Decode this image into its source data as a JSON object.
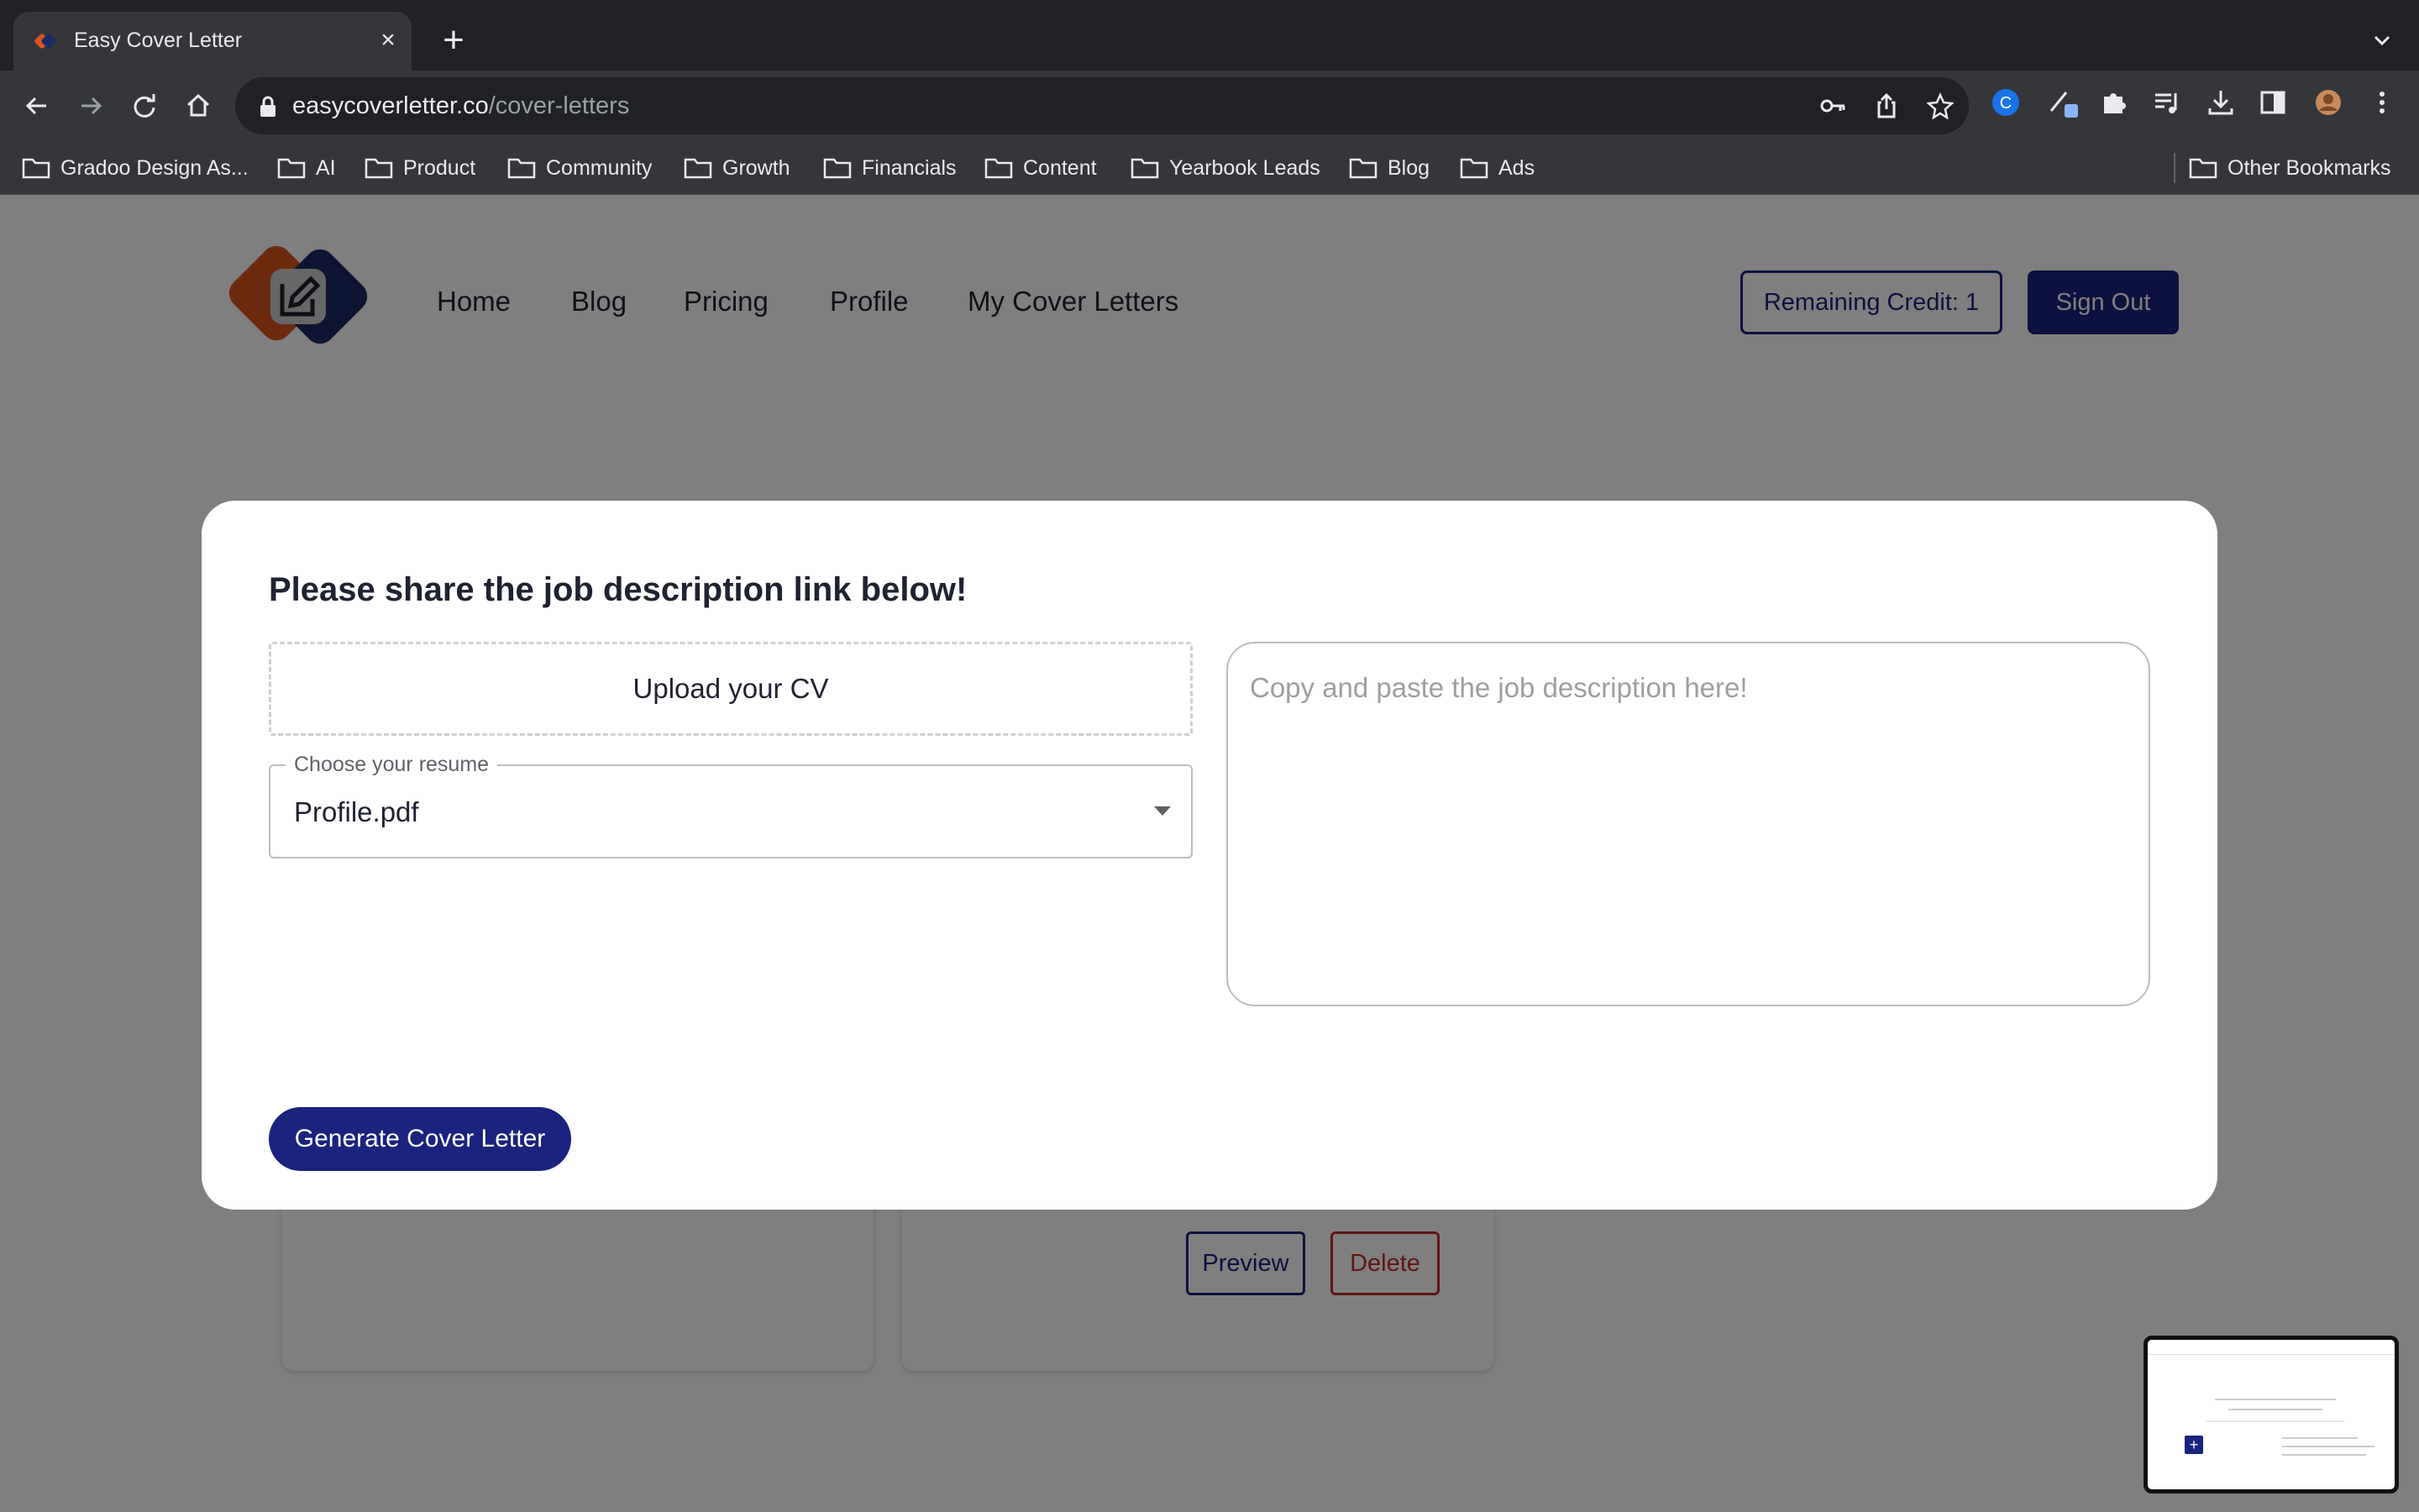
{
  "browser": {
    "tab_title": "Easy Cover Letter",
    "url_host": "easycoverletter.co",
    "url_path": "/cover-letters",
    "bookmarks": [
      "Gradoo Design As...",
      "AI",
      "Product",
      "Community",
      "Growth",
      "Financials",
      "Content",
      "Yearbook Leads",
      "Blog",
      "Ads"
    ],
    "other_bookmarks": "Other Bookmarks"
  },
  "site": {
    "nav": [
      "Home",
      "Blog",
      "Pricing",
      "Profile",
      "My Cover Letters"
    ],
    "credit_label": "Remaining Credit: 1",
    "signout_label": "Sign Out",
    "colors": {
      "primary": "#1a237e",
      "logo_orange": "#d9541e",
      "logo_navy": "#1c2a64",
      "danger": "#c62828"
    }
  },
  "background_card": {
    "preview_label": "Preview",
    "delete_label": "Delete"
  },
  "modal": {
    "title": "Please share the job description link below!",
    "upload_label": "Upload your CV",
    "resume_select_label": "Choose your resume",
    "resume_selected": "Profile.pdf",
    "job_description_placeholder": "Copy and paste the job description here!",
    "generate_label": "Generate Cover Letter"
  }
}
